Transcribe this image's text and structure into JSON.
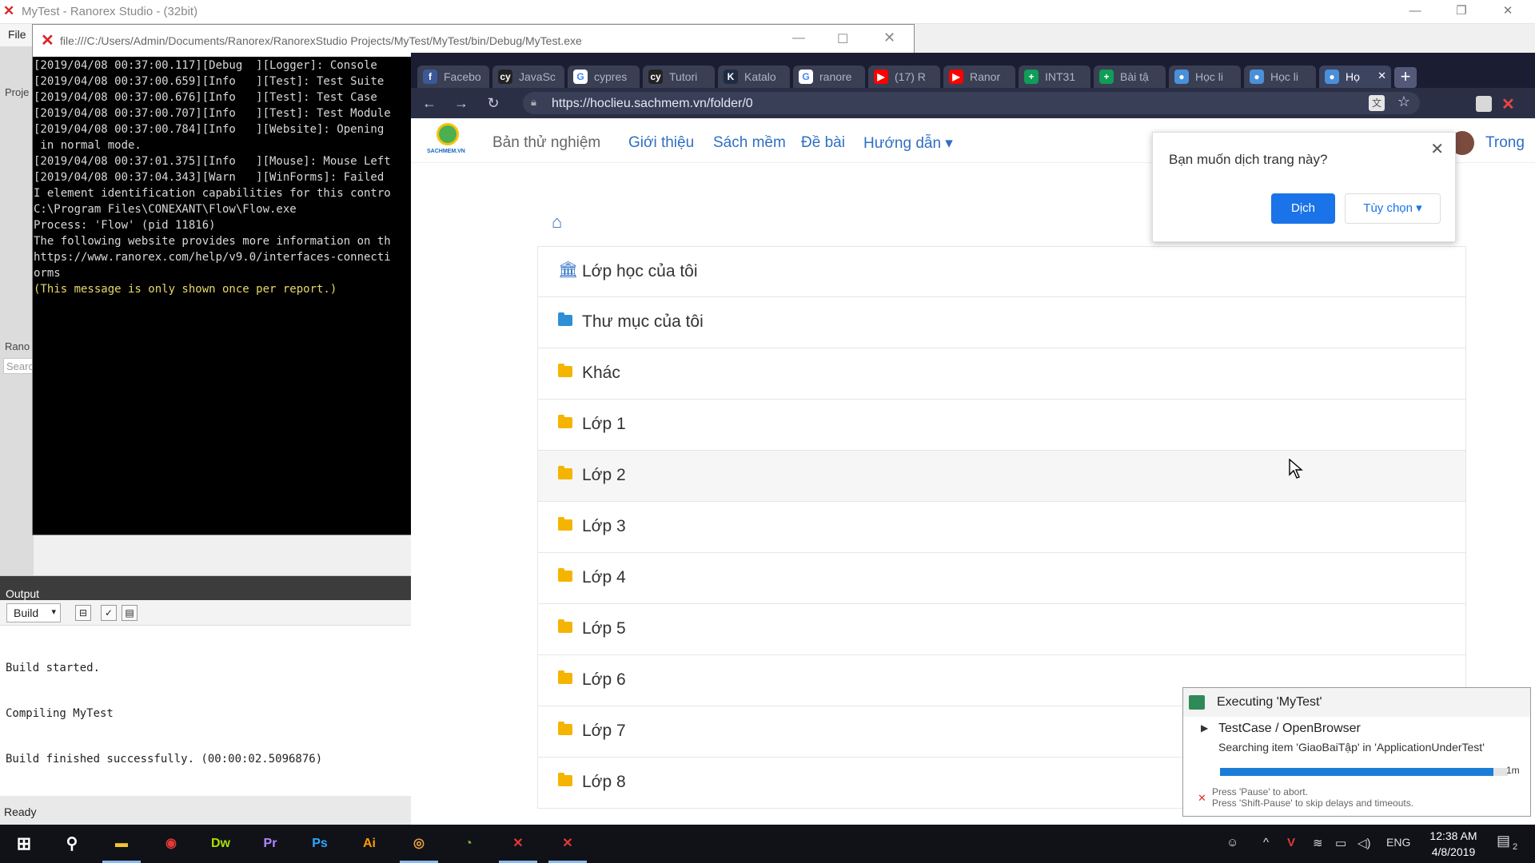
{
  "ranorex": {
    "title": "MyTest - Ranorex Studio - (32bit)",
    "menu_file": "File",
    "stubs": {
      "project": "Proje",
      "ranorex": "Rano",
      "search": "Search"
    }
  },
  "console": {
    "title": "file:///C:/Users/Admin/Documents/Ranorex/RanorexStudio Projects/MyTest/MyTest/bin/Debug/MyTest.exe",
    "lines": [
      "[2019/04/08 00:37:00.117][Debug  ][Logger]: Console",
      "[2019/04/08 00:37:00.659][Info   ][Test]: Test Suite",
      "[2019/04/08 00:37:00.676][Info   ][Test]: Test Case",
      "[2019/04/08 00:37:00.707][Info   ][Test]: Test Module",
      "[2019/04/08 00:37:00.784][Info   ][Website]: Opening",
      " in normal mode.",
      "[2019/04/08 00:37:01.375][Info   ][Mouse]: Mouse Left",
      "[2019/04/08 00:37:04.343][Warn   ][WinForms]: Failed",
      "I element identification capabilities for this contro",
      "C:\\Program Files\\CONEXANT\\Flow\\Flow.exe",
      "Process: 'Flow' (pid 11816)",
      "The following website provides more information on th",
      "https://www.ranorex.com/help/v9.0/interfaces-connecti",
      "orms",
      "(This message is only shown once per report.)"
    ]
  },
  "output": {
    "header": "Output",
    "select_value": "Build",
    "log": [
      "Build started.",
      "Compiling MyTest",
      "Build finished successfully. (00:00:02.5096876)"
    ],
    "status": "Ready"
  },
  "browser": {
    "tabs": [
      {
        "label": "Facebo",
        "icon": "facebook-icon",
        "color": "#3b5998",
        "glyph": "f"
      },
      {
        "label": "JavaSc",
        "icon": "cypress-icon",
        "color": "#222222",
        "glyph": "cy"
      },
      {
        "label": "cypres",
        "icon": "google-icon",
        "color": "#ffffff",
        "glyph": "G"
      },
      {
        "label": "Tutori",
        "icon": "cypress-icon",
        "color": "#222222",
        "glyph": "cy"
      },
      {
        "label": "Katalo",
        "icon": "katalon-icon",
        "color": "#1f2a44",
        "glyph": "K"
      },
      {
        "label": "ranore",
        "icon": "google-icon",
        "color": "#ffffff",
        "glyph": "G"
      },
      {
        "label": "(17) R",
        "icon": "youtube-icon",
        "color": "#ff0000",
        "glyph": "▶"
      },
      {
        "label": "Ranor",
        "icon": "youtube-icon",
        "color": "#ff0000",
        "glyph": "▶"
      },
      {
        "label": "INT31",
        "icon": "sheets-icon",
        "color": "#0f9d58",
        "glyph": "+"
      },
      {
        "label": "Bài tậ",
        "icon": "sheets-icon",
        "color": "#0f9d58",
        "glyph": "+"
      },
      {
        "label": "Học li",
        "icon": "sachmem-icon",
        "color": "#4a90d9",
        "glyph": "●"
      },
      {
        "label": "Học li",
        "icon": "sachmem-icon",
        "color": "#4a90d9",
        "glyph": "●"
      },
      {
        "label": "Họ",
        "icon": "sachmem-icon",
        "color": "#4a90d9",
        "glyph": "●",
        "active": true
      }
    ],
    "url": "https://hoclieu.sachmem.vn/folder/0"
  },
  "site": {
    "logo_text": "SACHMEM.VN",
    "brand": "Bản thử nghiệm",
    "nav": [
      "Giới thiệu",
      "Sách mềm",
      "Đề bài",
      "Hướng dẫn ▾"
    ],
    "user": "Trong",
    "folders": [
      {
        "label": "Lớp học của tôi",
        "icon": "institution-icon"
      },
      {
        "label": "Thư mục của tôi",
        "icon": "folder-icon-blue"
      },
      {
        "label": "Khác",
        "icon": "folder-icon"
      },
      {
        "label": "Lớp 1",
        "icon": "folder-icon"
      },
      {
        "label": "Lớp 2",
        "icon": "folder-icon",
        "hover": true
      },
      {
        "label": "Lớp 3",
        "icon": "folder-icon"
      },
      {
        "label": "Lớp 4",
        "icon": "folder-icon"
      },
      {
        "label": "Lớp 5",
        "icon": "folder-icon"
      },
      {
        "label": "Lớp 6",
        "icon": "folder-icon"
      },
      {
        "label": "Lớp 7",
        "icon": "folder-icon"
      },
      {
        "label": "Lớp 8",
        "icon": "folder-icon"
      }
    ]
  },
  "translate": {
    "question": "Bạn muốn dịch trang này?",
    "translate_btn": "Dịch",
    "options_btn": "Tùy chọn ▾"
  },
  "exec": {
    "title": "Executing 'MyTest'",
    "case": "TestCase / OpenBrowser",
    "searching": "Searching item 'GiaoBaiTập' in 'ApplicationUnderTest'",
    "progress": 0.95,
    "duration": "1m",
    "hint1": "Press 'Pause' to abort.",
    "hint2": "Press 'Shift-Pause' to skip delays and timeouts."
  },
  "taskbar": {
    "apps": [
      {
        "name": "file-explorer",
        "glyph": "▬",
        "color": "#f4c430",
        "active": true
      },
      {
        "name": "garena",
        "glyph": "◉",
        "color": "#e53935"
      },
      {
        "name": "dreamweaver",
        "glyph": "Dw",
        "color": "#a8e000"
      },
      {
        "name": "premiere",
        "glyph": "Pr",
        "color": "#b388ff"
      },
      {
        "name": "photoshop",
        "glyph": "Ps",
        "color": "#31a8ff"
      },
      {
        "name": "illustrator",
        "glyph": "Ai",
        "color": "#ff9a00"
      },
      {
        "name": "chrome",
        "glyph": "◎",
        "color": "#e8a33d",
        "active": true
      },
      {
        "name": "coccoc",
        "glyph": "◔",
        "color": "#7bc043"
      },
      {
        "name": "ranorex-studio",
        "glyph": "✕",
        "color": "#e53935",
        "active": true
      },
      {
        "name": "ranorex-runner",
        "glyph": "✕",
        "color": "#e53935",
        "active": true
      }
    ],
    "lang": "ENG",
    "time": "12:38 AM",
    "date": "4/8/2019",
    "notif_count": "2"
  }
}
